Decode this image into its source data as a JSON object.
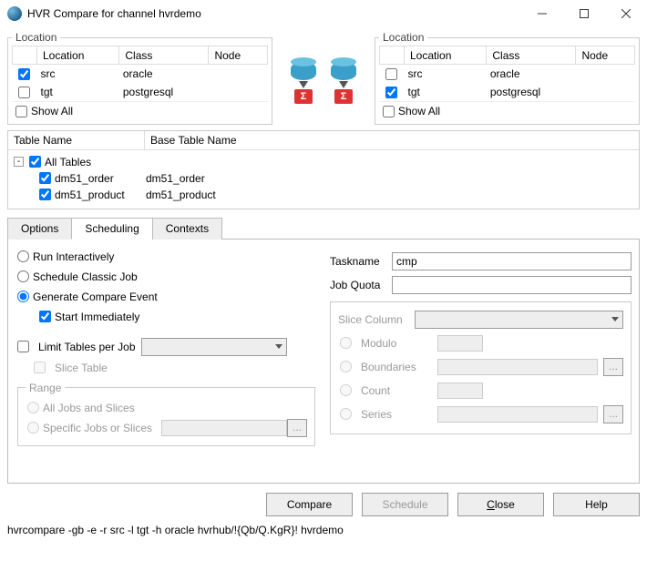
{
  "window": {
    "title": "HVR Compare for channel hvrdemo"
  },
  "leftLocation": {
    "legend": "Location",
    "headers": {
      "c0": "",
      "c1": "Location",
      "c2": "Class",
      "c3": "Node"
    },
    "rows": [
      {
        "checked": true,
        "location": "src",
        "class": "oracle",
        "node": ""
      },
      {
        "checked": false,
        "location": "tgt",
        "class": "postgresql",
        "node": ""
      }
    ],
    "showAll": "Show All"
  },
  "rightLocation": {
    "legend": "Location",
    "headers": {
      "c0": "",
      "c1": "Location",
      "c2": "Class",
      "c3": "Node"
    },
    "rows": [
      {
        "checked": false,
        "location": "src",
        "class": "oracle",
        "node": ""
      },
      {
        "checked": true,
        "location": "tgt",
        "class": "postgresql",
        "node": ""
      }
    ],
    "showAll": "Show All"
  },
  "tables": {
    "hdr1": "Table Name",
    "hdr2": "Base Table Name",
    "root": "All Tables",
    "items": [
      {
        "name": "dm51_order",
        "base": "dm51_order"
      },
      {
        "name": "dm51_product",
        "base": "dm51_product"
      }
    ]
  },
  "tabs": {
    "options": "Options",
    "scheduling": "Scheduling",
    "contexts": "Contexts"
  },
  "sched": {
    "runInteractively": "Run Interactively",
    "scheduleClassic": "Schedule Classic Job",
    "genEvent": "Generate Compare Event",
    "startImmediately": "Start Immediately",
    "limitTables": "Limit Tables per Job",
    "sliceTable": "Slice Table",
    "rangeLegend": "Range",
    "allJobs": "All Jobs and Slices",
    "specificJobs": "Specific Jobs or Slices",
    "tasknameLabel": "Taskname",
    "tasknameValue": "cmp",
    "jobQuotaLabel": "Job Quota",
    "jobQuotaValue": "",
    "sliceColumnLabel": "Slice Column",
    "modulo": "Modulo",
    "boundaries": "Boundaries",
    "count": "Count",
    "series": "Series"
  },
  "buttons": {
    "compare": "Compare",
    "schedule": "Schedule",
    "close_pre": "",
    "close_u": "C",
    "close_post": "lose",
    "help": "Help"
  },
  "cmdline": "hvrcompare -gb -e -r src -l tgt -h oracle hvrhub/!{Qb/Q.KgR}! hvrdemo",
  "sigma": "Σ"
}
